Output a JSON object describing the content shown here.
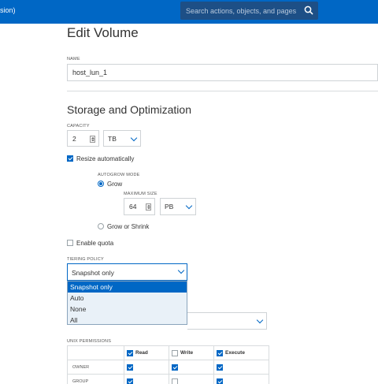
{
  "topbar": {
    "left_text": "sion)",
    "search_placeholder": "Search actions, objects, and pages",
    "search_icon": "search-icon",
    "color": "#0067c5"
  },
  "page_title": "Edit Volume",
  "name_field": {
    "label": "NAME",
    "value": "host_lun_1"
  },
  "section_title": "Storage and Optimization",
  "capacity": {
    "label": "CAPACITY",
    "value": "2",
    "unit": "TB"
  },
  "resize": {
    "label": "Resize automatically",
    "checked": true
  },
  "autogrow": {
    "label": "AUTOGROW MODE",
    "grow_label": "Grow",
    "grow_selected": true,
    "max_size_label": "MAXIMUM SIZE",
    "max_size_value": "64",
    "max_size_unit": "PB",
    "grow_shrink_label": "Grow or Shrink"
  },
  "quota": {
    "label": "Enable quota",
    "checked": false
  },
  "tiering": {
    "label": "TIERING POLICY",
    "selected": "Snapshot only",
    "options": [
      "Snapshot only",
      "Auto",
      "None",
      "All"
    ]
  },
  "unix_permissions": {
    "label": "UNIX PERMISSIONS",
    "columns": [
      {
        "label": "Read",
        "checked": true
      },
      {
        "label": "Write",
        "checked": false
      },
      {
        "label": "Execute",
        "checked": true
      }
    ],
    "rows": [
      {
        "label": "OWNER",
        "values": [
          true,
          true,
          true
        ]
      },
      {
        "label": "GROUP",
        "values": [
          true,
          false,
          true
        ]
      }
    ]
  }
}
